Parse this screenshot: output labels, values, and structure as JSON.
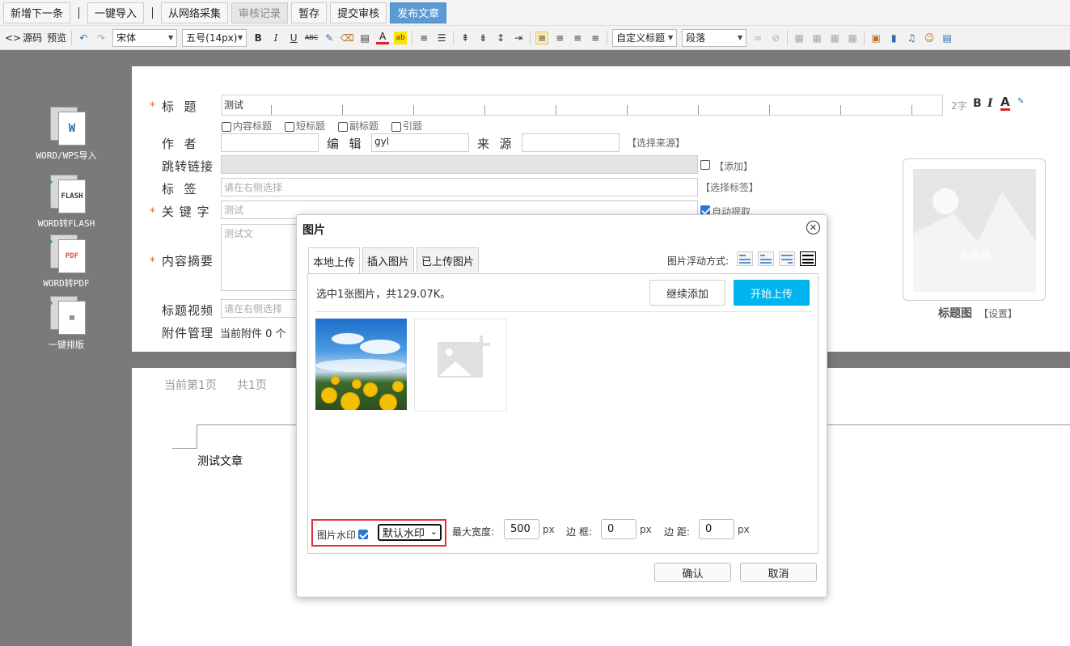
{
  "top_actions": {
    "add_next": "新增下一条",
    "one_click_import": "一键导入",
    "web_collect": "从网络采集",
    "review_log": "审核记录",
    "save_draft": "暂存",
    "submit_review": "提交审核",
    "publish": "发布文章"
  },
  "toolbar": {
    "source": "源码",
    "preview": "预览",
    "font_family": "宋体",
    "font_size": "五号(14px)",
    "heading_style": "自定义标题",
    "paragraph": "段落"
  },
  "sidebar": {
    "items": [
      {
        "label": "WORD/WPS导入",
        "icon": "word-import-icon",
        "badge": "W"
      },
      {
        "label": "WORD转FLASH",
        "icon": "word-to-flash-icon",
        "badge": "FLASH"
      },
      {
        "label": "WORD转PDF",
        "icon": "word-to-pdf-icon",
        "badge": "PDF"
      },
      {
        "label": "一键排版",
        "icon": "auto-layout-icon",
        "badge": ""
      }
    ]
  },
  "form": {
    "title_label": "标  题",
    "title_value": "测试",
    "title_word_count": "2字",
    "title_options": [
      "内容标题",
      "短标题",
      "副标题",
      "引题"
    ],
    "author_label": "作  者",
    "editor_label": "编  辑",
    "editor_value": "gyl",
    "source_label": "来  源",
    "select_source": "【选择来源】",
    "redirect_label": "跳转链接",
    "add_link": "【添加】",
    "tag_label": "标  签",
    "tag_placeholder": "请在右侧选择",
    "select_tag": "【选择标签】",
    "keyword_label": "关 键 字",
    "keyword_placeholder": "测试",
    "auto_extract": "自动提取",
    "summary_label": "内容摘要",
    "summary_placeholder": "测试文",
    "video_label": "标题视频",
    "video_placeholder": "请在右侧选择",
    "attachment_label": "附件管理",
    "attachment_text": "当前附件 0 个",
    "thumb_not_selected": "未选择",
    "thumb_label": "标题图",
    "thumb_settings": "【设置】"
  },
  "content": {
    "current_page": "当前第1页",
    "total_pages": "共1页",
    "body_text": "测试文章"
  },
  "dialog": {
    "title": "图片",
    "tabs": [
      "本地上传",
      "插入图片",
      "已上传图片"
    ],
    "float_label": "图片浮动方式:",
    "upload_info": "选中1张图片，共129.07K。",
    "continue_add": "继续添加",
    "start_upload": "开始上传",
    "watermark_label": "图片水印",
    "watermark_option": "默认水印",
    "max_width_label": "最大宽度:",
    "max_width_value": "500",
    "border_label": "边 框:",
    "border_value": "0",
    "margin_label": "边 距:",
    "margin_value": "0",
    "unit": "px",
    "confirm": "确认",
    "cancel": "取消"
  },
  "colors": {
    "primary_blue": "#00b4f0",
    "publish_blue": "#5b9bd5",
    "highlight_red": "#e0303a",
    "required_orange": "#e06a2e"
  }
}
